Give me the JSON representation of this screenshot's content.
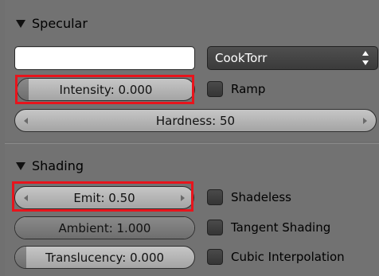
{
  "specular": {
    "title": "Specular",
    "shader": "CookTorr",
    "intensity_label": "Intensity: 0.000",
    "ramp_label": "Ramp",
    "hardness_label": "Hardness: 50"
  },
  "shading": {
    "title": "Shading",
    "emit_label": "Emit: 0.50",
    "ambient_label": "Ambient: 1.000",
    "translucency_label": "Translucency: 0.000",
    "shadeless_label": "Shadeless",
    "tangent_label": "Tangent Shading",
    "cubic_label": "Cubic Interpolation"
  },
  "colors": {
    "highlight": "#e8141c",
    "specular_color": "#ffffff"
  }
}
